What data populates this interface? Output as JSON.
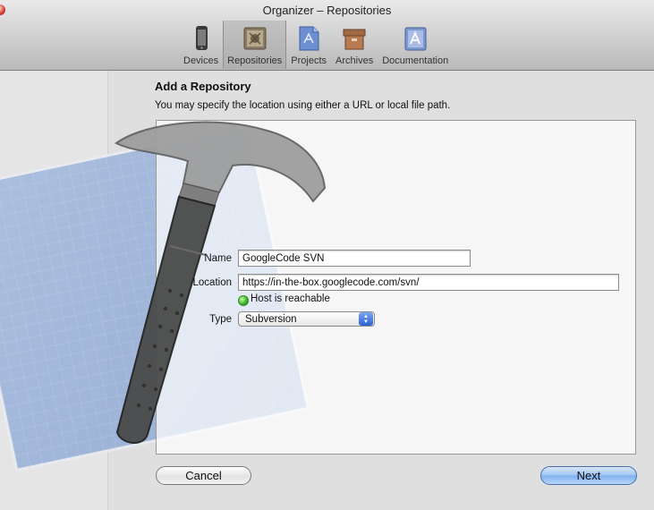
{
  "window": {
    "title": "Organizer – Repositories"
  },
  "toolbar": {
    "items": [
      {
        "label": "Devices",
        "icon": "device-icon"
      },
      {
        "label": "Repositories",
        "icon": "repository-icon",
        "selected": true
      },
      {
        "label": "Projects",
        "icon": "projects-icon"
      },
      {
        "label": "Archives",
        "icon": "archive-box-icon"
      },
      {
        "label": "Documentation",
        "icon": "documentation-icon"
      }
    ]
  },
  "sheet": {
    "heading": "Add a Repository",
    "subheading": "You may specify the location using either a URL or local file path.",
    "name_label": "Name",
    "name_value": "GoogleCode SVN",
    "location_label": "Location",
    "location_value": "https://in-the-box.googlecode.com/svn/",
    "status_text": "Host is reachable",
    "status_color": "#35b12a",
    "type_label": "Type",
    "type_value": "Subversion",
    "cancel_label": "Cancel",
    "next_label": "Next"
  }
}
